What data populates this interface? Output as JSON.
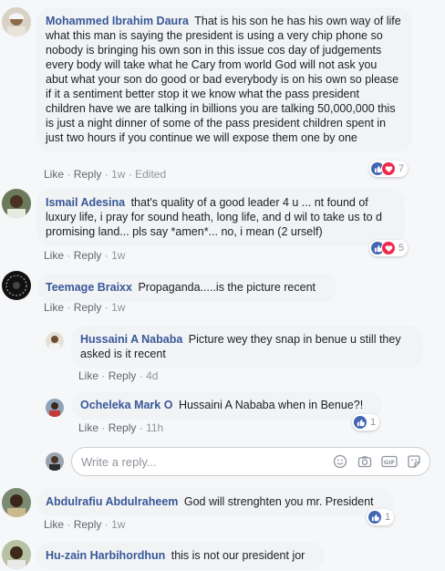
{
  "actions": {
    "like": "Like",
    "reply": "Reply",
    "dot": "·",
    "edited": "Edited"
  },
  "comments": [
    {
      "author": "Mohammed Ibrahim Daura",
      "text": "That is his son he has his own way of life what this man is saying the president is using a very chip phone so nobody is bringing his own son in this issue cos day of judgements every body will take what he Cary from world God will not ask you abut what your son do good or bad everybody is on his own so please if it a sentiment better stop it we know what the pass president children have we are talking in billions you are talking 50,000,000 this is just a night dinner of some of the pass president children spent in just two hours if you continue we will expose them one by one",
      "time": "1w",
      "reactions": "7"
    },
    {
      "author": "Ismail Adesina",
      "text": "that's quality of a good leader 4 u ... nt found of luxury life, i pray for sound heath, long life, and d wil to take us to d promising land... pls say *amen*... no, i mean (2 urself)",
      "time": "1w",
      "reactions": "5"
    },
    {
      "author": "Teemage Braixx",
      "text": "Propaganda.....is the picture recent",
      "time": "1w"
    },
    {
      "author": "Abdulrafiu Abdulraheem",
      "text": "God will strenghten you mr. President",
      "time": "1w",
      "reactions": "1"
    },
    {
      "author": "Hu-zain Harbihordhun",
      "text": "this is not our president jor"
    }
  ],
  "replies": [
    {
      "author": "Hussaini A Nababa",
      "text": "Picture wey they snap in benue u still they asked is it recent",
      "time": "4d"
    },
    {
      "author": "Ocheleka Mark O",
      "text": "Hussaini A Nababa when in Benue?!",
      "time": "11h",
      "reactions": "1"
    }
  ],
  "reply_box": {
    "placeholder": "Write a reply..."
  },
  "colors": {
    "link": "#385898",
    "like": "#4267b2",
    "love": "#f0284a",
    "bubble": "#f2f3f5"
  }
}
